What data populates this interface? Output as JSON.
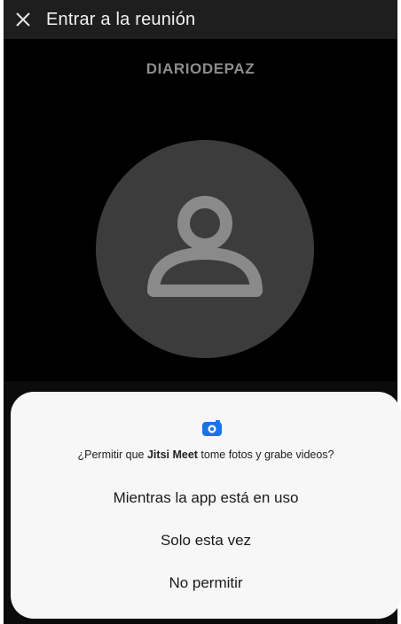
{
  "appbar": {
    "title": "Entrar a la reunión",
    "close_icon": "close-icon"
  },
  "meeting": {
    "room_name": "DIARIODEPAZ",
    "avatar_icon": "user-placeholder-icon"
  },
  "permission_dialog": {
    "icon": "camera-icon",
    "accent_color": "#1a73e8",
    "question_prefix": "¿Permitir que ",
    "app_name": "Jitsi Meet",
    "question_suffix": " tome fotos y grabe videos?",
    "options": [
      {
        "label": "Mientras la app está en uso"
      },
      {
        "label": "Solo esta vez"
      },
      {
        "label": "No permitir"
      }
    ]
  }
}
